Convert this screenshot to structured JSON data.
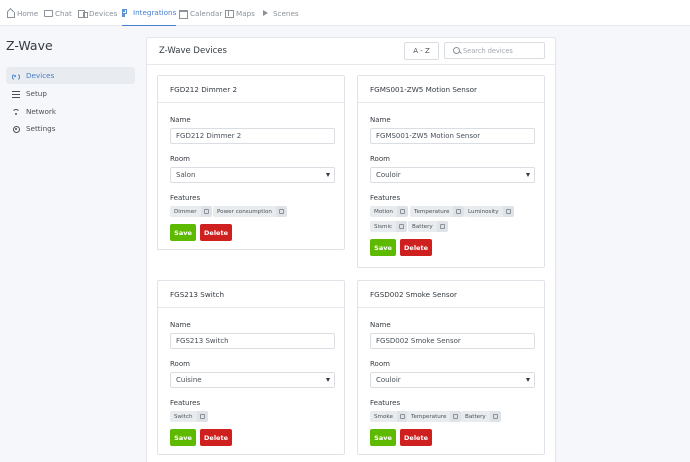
{
  "nav": {
    "items": [
      {
        "label": "Home",
        "icon": "home-icon"
      },
      {
        "label": "Chat",
        "icon": "chat-icon"
      },
      {
        "label": "Devices",
        "icon": "devices-icon"
      },
      {
        "label": "Integrations",
        "icon": "grid-icon"
      },
      {
        "label": "Calendar",
        "icon": "calendar-icon"
      },
      {
        "label": "Maps",
        "icon": "map-icon"
      },
      {
        "label": "Scenes",
        "icon": "play-icon"
      }
    ],
    "active": "Integrations",
    "accent": "#467fcf"
  },
  "sidebar": {
    "title": "Z-Wave",
    "items": [
      {
        "label": "Devices",
        "icon": "zwave-icon"
      },
      {
        "label": "Setup",
        "icon": "sliders-icon"
      },
      {
        "label": "Network",
        "icon": "wifi-icon"
      },
      {
        "label": "Settings",
        "icon": "gear-icon"
      }
    ],
    "active": "Devices"
  },
  "main": {
    "title": "Z-Wave Devices",
    "sort_label": "A - Z",
    "search_placeholder": "Search devices",
    "labels": {
      "name": "Name",
      "room": "Room",
      "features": "Features"
    },
    "save_label": "Save",
    "delete_label": "Delete",
    "save_color": "#5eba00",
    "delete_color": "#cd201f",
    "devices": [
      {
        "title": "FGD212 Dimmer 2",
        "name": "FGD212 Dimmer 2",
        "room": "Salon",
        "features": [
          {
            "label": "Dimmer",
            "icon": "dimmer-icon"
          },
          {
            "label": "Power consumption",
            "icon": "power-icon"
          }
        ]
      },
      {
        "title": "FGMS001-ZW5 Motion Sensor",
        "name": "FGMS001-ZW5 Motion Sensor",
        "room": "Couloir",
        "features": [
          {
            "label": "Motion",
            "icon": "eye-icon"
          },
          {
            "label": "Temperature",
            "icon": "thermometer-icon"
          },
          {
            "label": "Luminosity",
            "icon": "sun-icon"
          },
          {
            "label": "Sismic",
            "icon": "activity-icon"
          },
          {
            "label": "Battery",
            "icon": "battery-icon"
          }
        ]
      },
      {
        "title": "FGS213 Switch",
        "name": "FGS213 Switch",
        "room": "Cuisine",
        "features": [
          {
            "label": "Switch",
            "icon": "power-button-icon"
          }
        ]
      },
      {
        "title": "FGSD002 Smoke Sensor",
        "name": "FGSD002 Smoke Sensor",
        "room": "Couloir",
        "features": [
          {
            "label": "Smoke",
            "icon": "smoke-icon"
          },
          {
            "label": "Temperature",
            "icon": "thermometer-icon"
          },
          {
            "label": "Battery",
            "icon": "battery-icon"
          }
        ]
      }
    ]
  }
}
